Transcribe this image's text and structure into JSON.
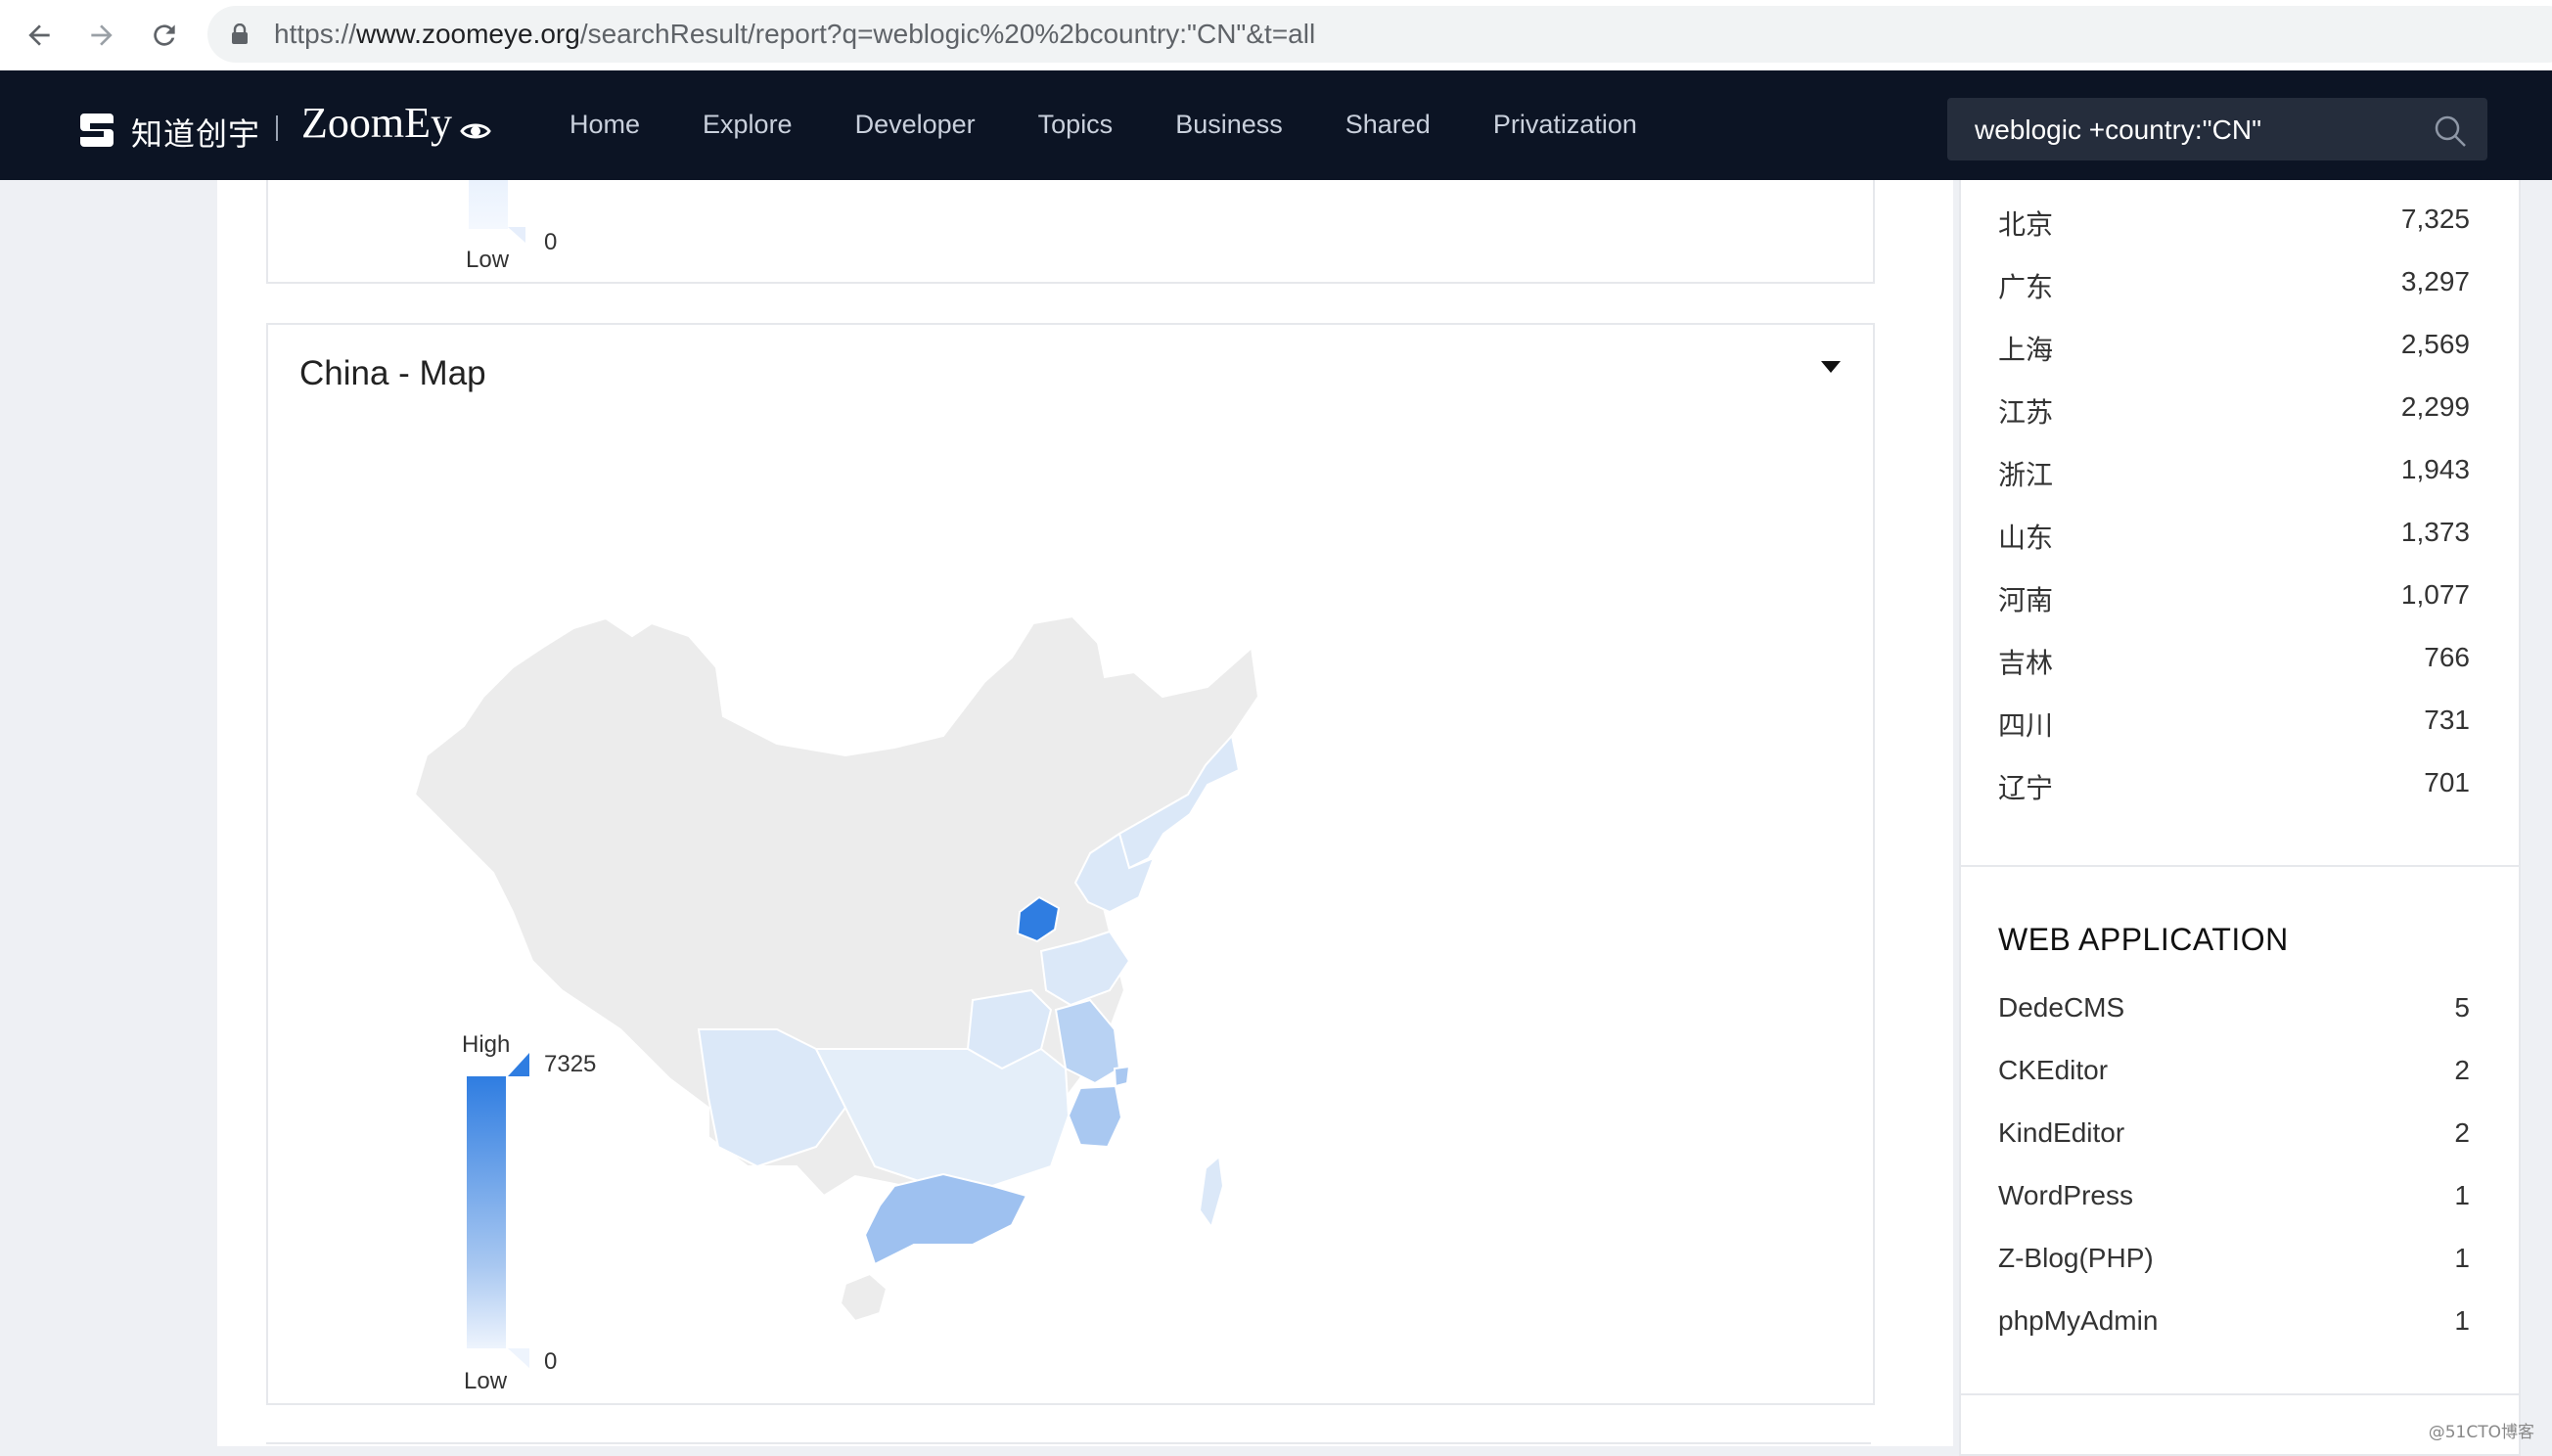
{
  "browser": {
    "url_prefix": "https://",
    "url_host": "www.zoomeye.org",
    "url_path": "/searchResult/report?q=weblogic%20%2bcountry:\"CN\"&t=all"
  },
  "header": {
    "logo_cn": "知道创宇",
    "logo_en": "ZoomEy",
    "nav": [
      "Home",
      "Explore",
      "Developer",
      "Topics",
      "Business",
      "Shared",
      "Privatization"
    ],
    "search_value": "weblogic +country:\"CN\""
  },
  "top_panel": {
    "legend_low": "Low",
    "legend_min": "0"
  },
  "map_panel": {
    "title": "China - Map",
    "legend_high": "High",
    "legend_max": "7325",
    "legend_low": "Low",
    "legend_min": "0",
    "colors": {
      "max": "#2f7de1",
      "mid": "#a9c8f1",
      "low": "#dbe8f8",
      "none": "#ececec"
    }
  },
  "provinces": {
    "rows": [
      {
        "name": "北京",
        "count": "7,325"
      },
      {
        "name": "广东",
        "count": "3,297"
      },
      {
        "name": "上海",
        "count": "2,569"
      },
      {
        "name": "江苏",
        "count": "2,299"
      },
      {
        "name": "浙江",
        "count": "1,943"
      },
      {
        "name": "山东",
        "count": "1,373"
      },
      {
        "name": "河南",
        "count": "1,077"
      },
      {
        "name": "吉林",
        "count": "766"
      },
      {
        "name": "四川",
        "count": "731"
      },
      {
        "name": "辽宁",
        "count": "701"
      }
    ]
  },
  "web_application": {
    "title": "WEB APPLICATION",
    "rows": [
      {
        "name": "DedeCMS",
        "count": "5"
      },
      {
        "name": "CKEditor",
        "count": "2"
      },
      {
        "name": "KindEditor",
        "count": "2"
      },
      {
        "name": "WordPress",
        "count": "1"
      },
      {
        "name": "Z-Blog(PHP)",
        "count": "1"
      },
      {
        "name": "phpMyAdmin",
        "count": "1"
      }
    ]
  },
  "watermark": "@51CTO博客"
}
